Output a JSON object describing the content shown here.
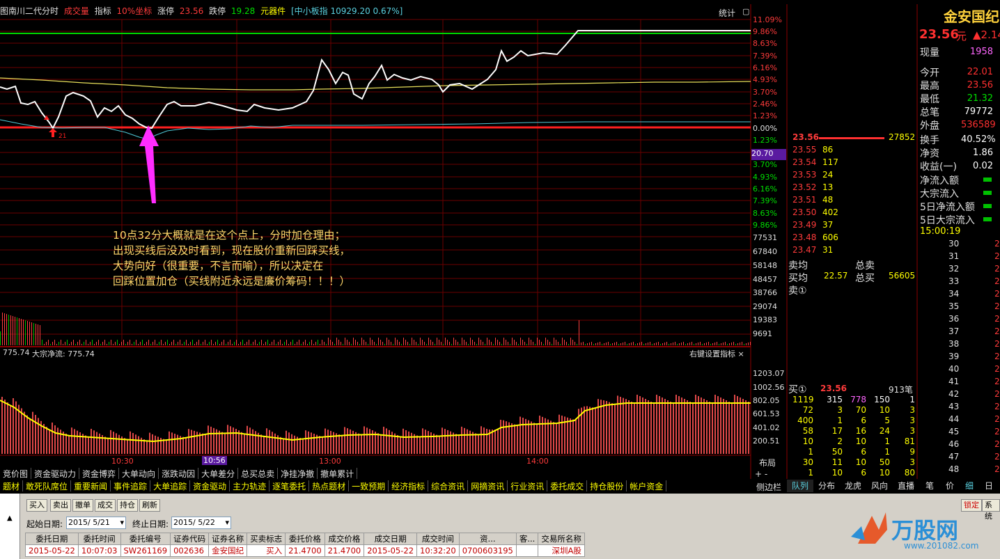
{
  "header": {
    "items": [
      "图南川二代分时",
      "成交量",
      "指标",
      "10%坐标",
      "涨停",
      "23.56",
      "跌停",
      "19.28",
      "元器件"
    ],
    "index_box": "[中小板指 10929.20 0.67%]",
    "stats": "统计"
  },
  "price_axis_labels": [
    "11.09%",
    "9.86%",
    "8.63%",
    "7.39%",
    "6.16%",
    "4.93%",
    "3.70%",
    "2.46%",
    "1.23%",
    "0.00%",
    "1.23%",
    "2.46%",
    "3.70%",
    "4.93%",
    "6.16%",
    "7.39%",
    "8.63%",
    "9.86%"
  ],
  "price_highlight": "20.70",
  "volume_axis_labels": [
    "77531",
    "67840",
    "58148",
    "48457",
    "38766",
    "29074",
    "19383",
    "9691"
  ],
  "marker_label": "21",
  "annotation": "10点32分大概就是在这个点上，分时加仓理由；\n出现买线后没及时看到，现在股价重新回踩买线，\n大势向好（很重要，不言而喻），所以决定在\n回踩位置加仓（买线附近永远是廉价筹码！！！）",
  "indicator": {
    "title_value": "775.74",
    "title_label": "大宗净流: 775.74",
    "settings": "右键设置指标 ×",
    "axis_labels": [
      "1203.07",
      "1002.56",
      "802.05",
      "601.53",
      "401.02",
      "200.51"
    ]
  },
  "time_axis": [
    "10:30",
    "10:56",
    "13:00",
    "14:00"
  ],
  "tab_row1": [
    "竞价图",
    "资金驱动力",
    "资金博弈",
    "大单动向",
    "涨跌动因",
    "大单差分",
    "总买总卖",
    "净挂净撤",
    "撤单累计"
  ],
  "tab_row2": [
    "题材",
    "敢死队席位",
    "重要新闻",
    "事件追踪",
    "大单追踪",
    "资金驱动",
    "主力轨迹",
    "逐笔委托",
    "热点题材",
    "一致预期",
    "经济指标",
    "综合资讯",
    "网摘资讯",
    "行业资讯",
    "委托成交",
    "持仓股份",
    "帐户资金"
  ],
  "layout_tabs": {
    "layout": "布局",
    "plusminus": "+ -",
    "sidebar": "侧边栏"
  },
  "right_tabs": [
    "队列",
    "分布",
    "龙虎",
    "风向",
    "直播",
    "笔",
    "价",
    "细",
    "日"
  ],
  "stock": {
    "name": "金安国纪",
    "price": "23.56",
    "unit": "元",
    "change": "▲2.14",
    "rows": [
      {
        "label": "现量",
        "value": "1958"
      },
      {
        "label": "今开",
        "value": "22.01"
      },
      {
        "label": "最高",
        "value": "23.56"
      },
      {
        "label": "最低",
        "value": "21.32"
      },
      {
        "label": "总笔",
        "value": "79772"
      },
      {
        "label": "外盘",
        "value": "536589"
      },
      {
        "label": "换手",
        "value": "40.52%"
      },
      {
        "label": "净资",
        "value": "1.86"
      },
      {
        "label": "收益(一)",
        "value": "0.02"
      },
      {
        "label": "净流入额",
        "value": ""
      },
      {
        "label": "大宗流入",
        "value": ""
      },
      {
        "label": "5日净流入额",
        "value": ""
      },
      {
        "label": "5日大宗流入",
        "value": ""
      }
    ],
    "time": "15:00:19",
    "tick_times": [
      "30",
      "31",
      "32",
      "33",
      "34",
      "35",
      "36",
      "37",
      "38",
      "39",
      "40",
      "41",
      "42",
      "43",
      "44",
      "45",
      "46",
      "47",
      "48"
    ]
  },
  "orderbook": {
    "top_bid_price": "23.56",
    "top_bid_vol": "27852",
    "levels": [
      {
        "p": "23.55",
        "v": "86"
      },
      {
        "p": "23.54",
        "v": "117"
      },
      {
        "p": "23.53",
        "v": "24"
      },
      {
        "p": "23.52",
        "v": "13"
      },
      {
        "p": "23.51",
        "v": "48"
      },
      {
        "p": "23.50",
        "v": "402"
      },
      {
        "p": "23.49",
        "v": "37"
      },
      {
        "p": "23.48",
        "v": "606"
      },
      {
        "p": "23.47",
        "v": "31"
      }
    ],
    "sell_avg_label": "卖均",
    "total_sell_label": "总卖",
    "buy_avg_label": "买均",
    "buy_avg": "22.57",
    "total_buy_label": "总买",
    "total_buy": "56605",
    "sell1": "卖①",
    "buy1_label": "买①",
    "buy1_price": "23.56",
    "buy1_count": "913笔",
    "queue": [
      [
        "1119",
        "315",
        "778",
        "150",
        "1"
      ],
      [
        "72",
        "3",
        "70",
        "10",
        "3"
      ],
      [
        "400",
        "1",
        "6",
        "5",
        "3"
      ],
      [
        "58",
        "17",
        "16",
        "24",
        "3"
      ],
      [
        "10",
        "2",
        "10",
        "1",
        "81"
      ],
      [
        "1",
        "50",
        "6",
        "1",
        "9"
      ],
      [
        "30",
        "11",
        "10",
        "50",
        "3"
      ],
      [
        "1",
        "10",
        "6",
        "10",
        "80"
      ]
    ]
  },
  "trade_panel": {
    "buttons": [
      "买入",
      "卖出",
      "撤单",
      "成交",
      "持仓",
      "刷新"
    ],
    "start_label": "起始日期:",
    "start_date": "2015/ 5/21",
    "end_label": "终止日期:",
    "end_date": "2015/ 5/22",
    "columns": [
      "委托日期",
      "委托时间",
      "委托编号",
      "证券代码",
      "证券名称",
      "买卖标志",
      "委托价格",
      "成交价格",
      "成交日期",
      "成交时间",
      "资...",
      "客...",
      "交易所名称"
    ],
    "row": [
      "2015-05-22",
      "10:07:03",
      "SW261169",
      "002636",
      "金安国纪",
      "买入",
      "21.4700",
      "21.4700",
      "2015-05-22",
      "10:32:20",
      "0700603195",
      "",
      "深圳A股"
    ],
    "right_buttons": [
      "锁定",
      "系统"
    ],
    "logo": "万股网",
    "logo_url": "www.201082.com"
  }
}
